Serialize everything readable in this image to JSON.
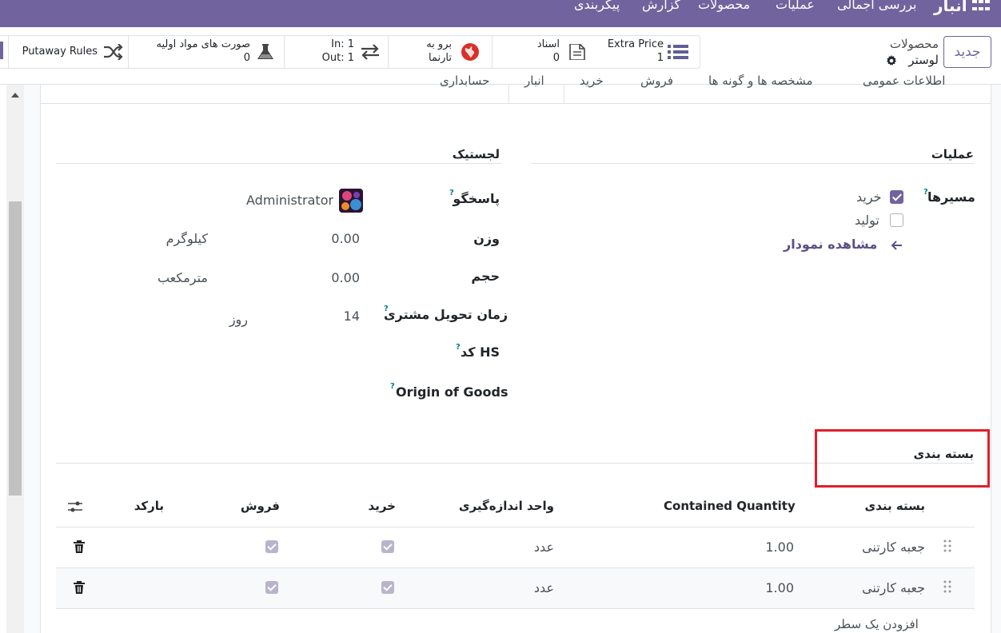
{
  "navbar": {
    "brand": "انبار",
    "menu": [
      "بررسی اجمالی",
      "عملیات",
      "محصولات",
      "گزارش",
      "پیکربندی"
    ]
  },
  "control_panel": {
    "new_button": "جدید",
    "breadcrumb_parent": "محصولات",
    "breadcrumb_current": "لوستر",
    "smart_buttons": [
      {
        "label": "Extra Price",
        "value": "1",
        "icon": "list-icon"
      },
      {
        "label": "اسناد",
        "value": "0",
        "icon": "document-icon"
      },
      {
        "label": "برو به",
        "value": "تارنما",
        "icon": "globe-icon"
      },
      {
        "label": "In: 1",
        "value": "Out: 1",
        "icon": "transfer-arrows-icon"
      },
      {
        "label": "صورت های مواد اولیه",
        "value": "0",
        "icon": "flask-icon"
      },
      {
        "label": "Putaway Rules",
        "value": "",
        "icon": "shuffle-icon"
      }
    ]
  },
  "tabs": [
    "اطلاعات عمومی",
    "مشخصه ها و گونه ها",
    "فروش",
    "خرید",
    "انبار",
    "حسابداری"
  ],
  "active_tab": "انبار",
  "operations": {
    "title": "عملیات",
    "routes_label": "مسیرها",
    "routes": [
      {
        "label": "خرید",
        "checked": true
      },
      {
        "label": "تولید",
        "checked": false
      }
    ],
    "diagram_link": "مشاهده نمودار"
  },
  "logistics": {
    "title": "لجستیک",
    "responsible_label": "پاسخگو",
    "responsible_value": "Administrator",
    "weight_label": "وزن",
    "weight_value": "0.00",
    "weight_unit": "کیلوگرم",
    "volume_label": "حجم",
    "volume_value": "0.00",
    "volume_unit": "مترمکعب",
    "lead_time_label": "زمان تحویل مشتری",
    "lead_time_value": "14",
    "lead_time_unit": "روز",
    "hs_code_label": "کد HS",
    "origin_label": "Origin of Goods"
  },
  "packaging": {
    "title": "بسته بندی",
    "columns": [
      "بسته بندی",
      "Contained Quantity",
      "واحد اندازه‌گیری",
      "خرید",
      "فروش",
      "بارکد"
    ],
    "rows": [
      {
        "name": "جعبه کارتنی",
        "qty": "1.00",
        "uom": "عدد",
        "purchase": true,
        "sales": true,
        "barcode": ""
      },
      {
        "name": "جعبه کارتنی",
        "qty": "1.00",
        "uom": "عدد",
        "purchase": true,
        "sales": true,
        "barcode": ""
      }
    ],
    "add_line": "افزودن یک سطر"
  },
  "colors": {
    "brand": "#71639e",
    "highlight": "#e01f2b"
  }
}
